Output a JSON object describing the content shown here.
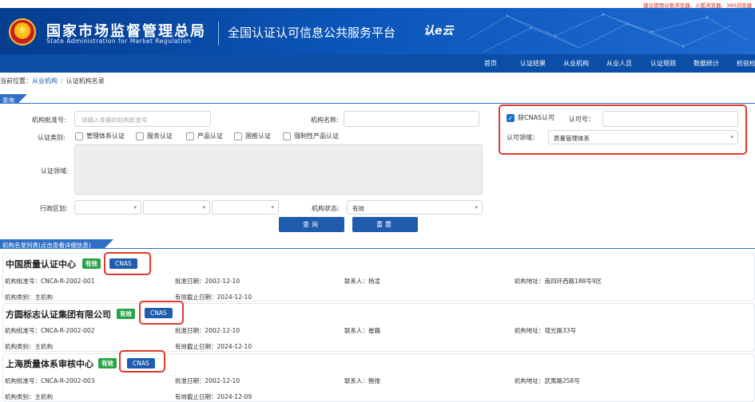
{
  "top_note": "建议使用谷歌浏览器、火狐浏览器、360浏览器",
  "header": {
    "brand_cn": "国家市场监督管理总局",
    "brand_en": "State Administration for Market Regulation",
    "platform": "全国认证认可信息公共服务平台",
    "logo_text": "认e云"
  },
  "nav": [
    "首页",
    "认证结果",
    "从业机构",
    "从业人员",
    "认证规则",
    "数据统计",
    "检验检"
  ],
  "breadcrumb": {
    "prefix": "当前位置：",
    "level1": "从业机构",
    "sep": "/",
    "level2": "认证机构名录"
  },
  "query": {
    "title": "查询条件",
    "approval_no_label": "机构批准号:",
    "approval_no_placeholder": "请输入准确的机构批准号",
    "name_label": "机构名称:",
    "cnas_label": "获CNAS认可",
    "cnas_checked": true,
    "accred_no_label": "认可号：",
    "accred_field_label": "认可领域：",
    "accred_field_value": "质量管理体系",
    "cert_type_label": "认证类别:",
    "cert_types": [
      "管理体系认证",
      "服务认证",
      "产品认证",
      "国推认证",
      "强制性产品认证"
    ],
    "cert_field_label": "认证领域:",
    "region_label": "行政区划:",
    "status_label": "机构状态:",
    "status_value": "有效",
    "search_btn": "查询",
    "reset_btn": "重置"
  },
  "list": {
    "title": "机构名录列表(点击查看详细信息)",
    "items": [
      {
        "name": "中国质量认证中心",
        "status": "有效",
        "cnas": "CNAS",
        "approval_no": "机构批准号：CNCA-R-2002-001",
        "approval_date": "批准日期：2002-12-10",
        "contact": "联系人：杨凌",
        "address": "机构地址：南四环西路188号9区",
        "category": "机构类别：主机构",
        "expiry": "有效截止日期：2024-12-10"
      },
      {
        "name": "方圆标志认证集团有限公司",
        "status": "有效",
        "cnas": "CNAS",
        "approval_no": "机构批准号：CNCA-R-2002-002",
        "approval_date": "批准日期：2002-12-10",
        "contact": "联系人：崔巍",
        "address": "机构地址：增光路33号",
        "category": "机构类别：主机构",
        "expiry": "有效截止日期：2024-12-10"
      },
      {
        "name": "上海质量体系审核中心",
        "status": "有效",
        "cnas": "CNAS",
        "approval_no": "机构批准号：CNCA-R-2002-003",
        "approval_date": "批准日期：2002-12-10",
        "contact": "联系人：鲍维",
        "address": "机构地址：武夷路258号",
        "category": "机构类别：主机构",
        "expiry": "有效截止日期：2024-12-09"
      }
    ]
  }
}
